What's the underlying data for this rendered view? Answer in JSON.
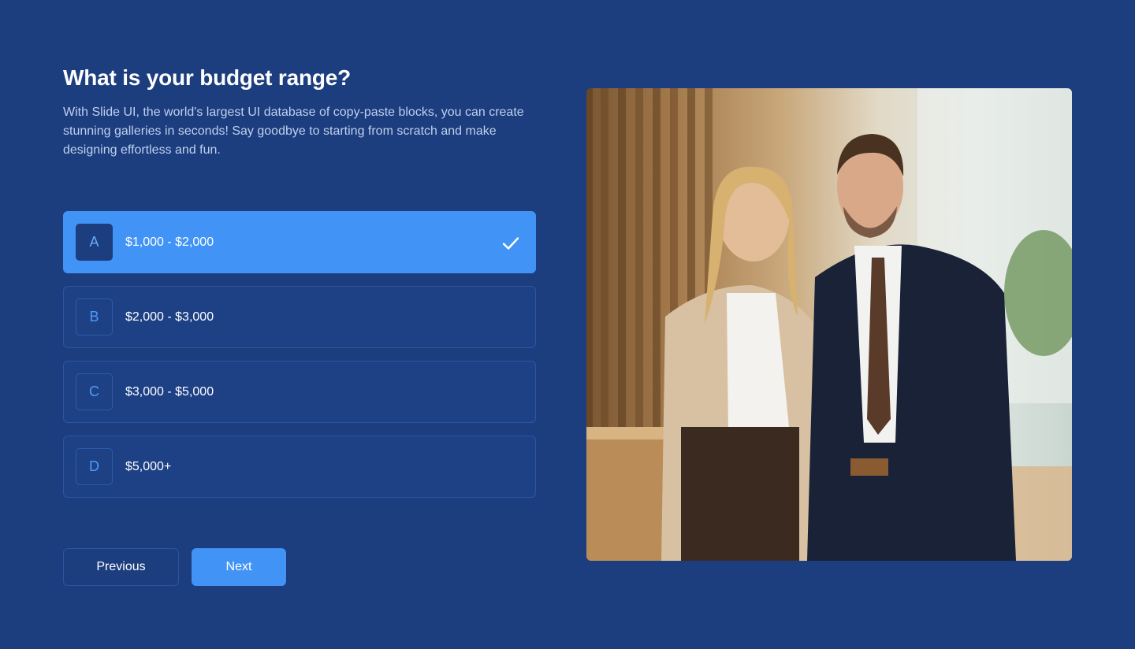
{
  "question": {
    "title": "What is your budget range?",
    "description": "With Slide UI, the world's largest UI database of copy-paste blocks, you can create stunning galleries in seconds! Say goodbye to starting from scratch and make designing effortless and fun."
  },
  "options": [
    {
      "letter": "A",
      "label": "$1,000 - $2,000",
      "selected": true
    },
    {
      "letter": "B",
      "label": "$2,000 - $3,000",
      "selected": false
    },
    {
      "letter": "C",
      "label": "$3,000 - $5,000",
      "selected": false
    },
    {
      "letter": "D",
      "label": "$5,000+",
      "selected": false
    }
  ],
  "buttons": {
    "previous": "Previous",
    "next": "Next"
  },
  "colors": {
    "background": "#1c3d7e",
    "accent": "#4194f6",
    "option_bg": "#1e4186"
  },
  "icons": {
    "selected_check": "check-icon"
  }
}
